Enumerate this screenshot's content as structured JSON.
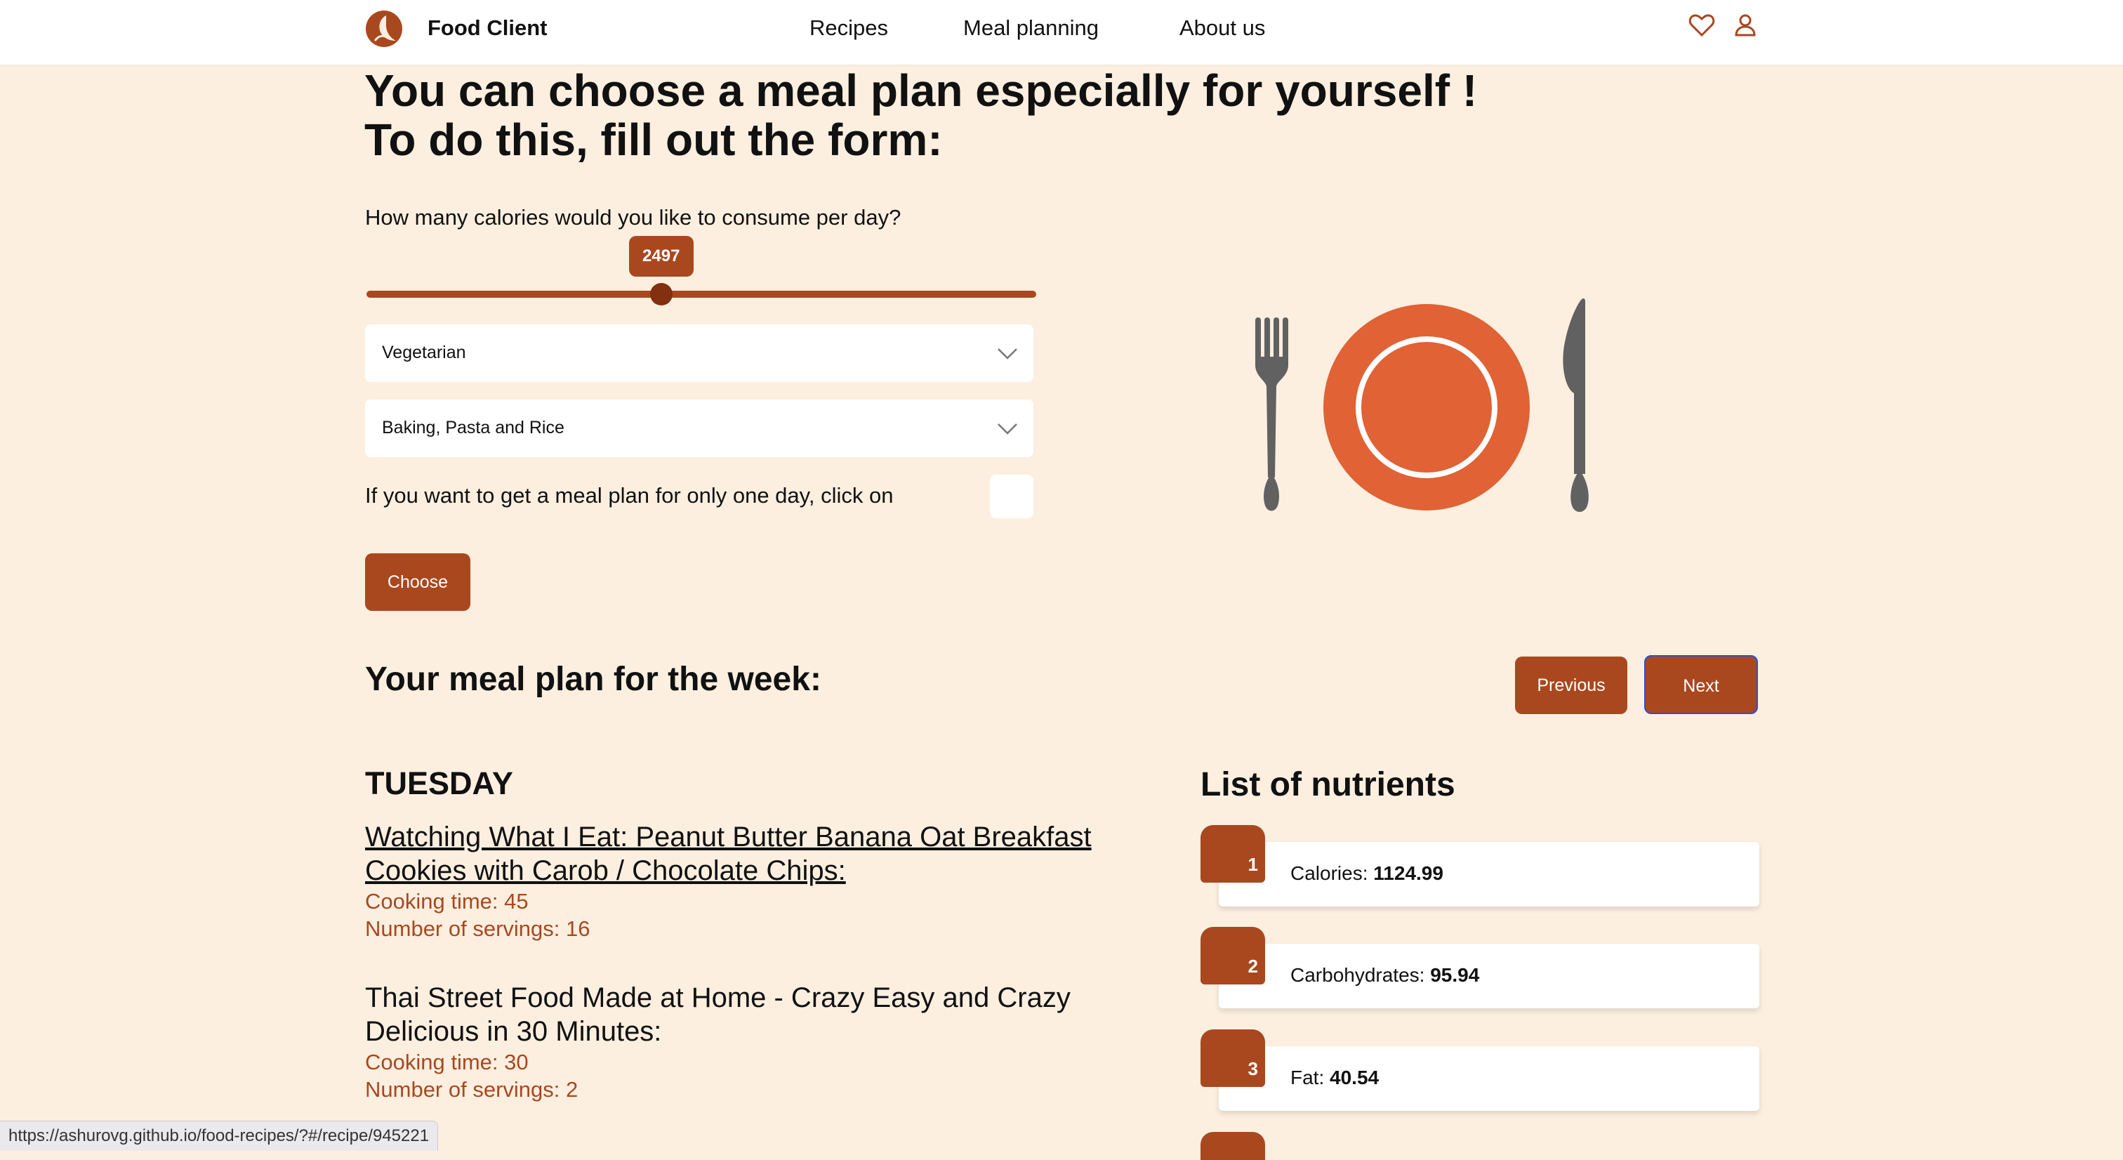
{
  "header": {
    "app_name": "Food Client",
    "nav": [
      "Recipes",
      "Meal planning",
      "About us"
    ],
    "icons": [
      "heart-icon",
      "user-icon"
    ]
  },
  "main": {
    "title_line1": "You can choose a meal plan especially for yourself !",
    "title_line2": "To do this, fill out the form:",
    "calories_question": "How many calories would you like to consume per day?",
    "calories_value": "2497",
    "calories_slider_fraction": 0.44,
    "diet_select": "Vegetarian",
    "category_select": "Baking, Pasta and Rice",
    "one_day_label": "If you want to get a meal plan for only one day, click on",
    "choose_button": "Choose"
  },
  "plan": {
    "title": "Your meal plan for the week:",
    "previous_button": "Previous",
    "next_button": "Next",
    "day": "TUESDAY",
    "recipes": [
      {
        "title_line1": "Watching What I Eat: Peanut Butter Banana Oat Breakfast",
        "title_line2": "Cookies with Carob / Chocolate Chips:",
        "cooking_time": "Cooking time: 45",
        "servings": "Number of servings: 16"
      },
      {
        "title_line1": "Thai Street Food Made at Home - Crazy Easy and Crazy",
        "title_line2": "Delicious in 30 Minutes:",
        "cooking_time": "Cooking time: 30",
        "servings": "Number of servings: 2"
      }
    ]
  },
  "nutrients": {
    "title": "List of nutrients",
    "items": [
      {
        "num": "1",
        "label": "Calories:",
        "value": "1124.99"
      },
      {
        "num": "2",
        "label": "Carbohydrates:",
        "value": "95.94"
      },
      {
        "num": "3",
        "label": "Fat:",
        "value": "40.54"
      }
    ]
  },
  "status_url": "https://ashurovg.github.io/food-recipes/?#/recipe/945221",
  "colors": {
    "accent": "#a9481f",
    "background": "#fcefe0",
    "plate": "#e06235",
    "utensils": "#616161"
  }
}
